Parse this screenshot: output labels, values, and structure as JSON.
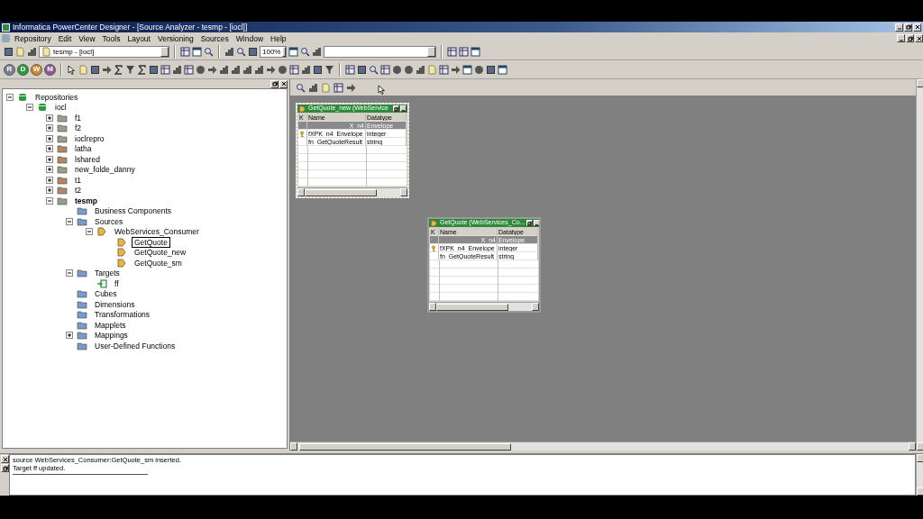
{
  "window": {
    "title": "Informatica PowerCenter Designer - [Source Analyzer - tesmp - [iocl]]"
  },
  "menu": [
    "Repository",
    "Edit",
    "View",
    "Tools",
    "Layout",
    "Versioning",
    "Sources",
    "Window",
    "Help"
  ],
  "toolbar": {
    "repository_combo": "tesmp - [iocl]",
    "zoom_combo": "100%"
  },
  "client_tools": [
    {
      "label": "R",
      "color": "#7a7f9a"
    },
    {
      "label": "D",
      "color": "#2f9a3a"
    },
    {
      "label": "W",
      "color": "#d8862a"
    },
    {
      "label": "M",
      "color": "#8a5a9a"
    }
  ],
  "tree": [
    {
      "label": "Repositories",
      "kind": "repositories",
      "selected": false,
      "expanded": true,
      "children": [
        {
          "label": "iocl",
          "kind": "repository",
          "selected": false,
          "expanded": true,
          "children": [
            {
              "label": "f1",
              "kind": "folder",
              "selected": false,
              "expanded": false
            },
            {
              "label": "f2",
              "kind": "folder",
              "selected": false,
              "expanded": false
            },
            {
              "label": "ioclrepro",
              "kind": "folder",
              "selected": false,
              "expanded": false
            },
            {
              "label": "latha",
              "kind": "shared-folder",
              "selected": false,
              "expanded": false
            },
            {
              "label": "lshared",
              "kind": "shared-folder",
              "selected": false,
              "expanded": false
            },
            {
              "label": "new_folde_danny",
              "kind": "folder",
              "selected": false,
              "expanded": false
            },
            {
              "label": "t1",
              "kind": "shared-folder",
              "selected": false,
              "expanded": false
            },
            {
              "label": "t2",
              "kind": "shared-folder",
              "selected": false,
              "expanded": false
            },
            {
              "label": "tesmp",
              "kind": "open-folder",
              "selected": false,
              "expanded": true,
              "children": [
                {
                  "label": "Business Components",
                  "kind": "node",
                  "selected": false
                },
                {
                  "label": "Sources",
                  "kind": "node",
                  "selected": false,
                  "expanded": true,
                  "children": [
                    {
                      "label": "WebServices_Consumer",
                      "kind": "source",
                      "selected": false,
                      "expanded": true,
                      "children": [
                        {
                          "label": "GetQuote",
                          "kind": "source",
                          "selected": true
                        },
                        {
                          "label": "GetQuote_new",
                          "kind": "source",
                          "selected": false
                        },
                        {
                          "label": "GetQuote_sm",
                          "kind": "source",
                          "selected": false
                        }
                      ]
                    }
                  ]
                },
                {
                  "label": "Targets",
                  "kind": "node",
                  "selected": false,
                  "expanded": true,
                  "children": [
                    {
                      "label": "ff",
                      "kind": "target",
                      "selected": false
                    }
                  ]
                },
                {
                  "label": "Cubes",
                  "kind": "node",
                  "selected": false
                },
                {
                  "label": "Dimensions",
                  "kind": "node",
                  "selected": false
                },
                {
                  "label": "Transformations",
                  "kind": "node",
                  "selected": false
                },
                {
                  "label": "Mapplets",
                  "kind": "node",
                  "selected": false
                },
                {
                  "label": "Mappings",
                  "kind": "node",
                  "selected": false,
                  "expanded": false
                },
                {
                  "label": "User-Defined Functions",
                  "kind": "node",
                  "selected": false
                }
              ]
            }
          ]
        }
      ]
    }
  ],
  "source_windows": [
    {
      "title": "GetQuote_new (WebService",
      "selected": true,
      "columns": [
        "K",
        "Name",
        "Datatype"
      ],
      "rows": [
        {
          "kind": "group",
          "name": "X_n4",
          "datatype": "Envelope"
        },
        {
          "kind": "key",
          "name": "fXPK_n4_Envelope",
          "datatype": "integer"
        },
        {
          "kind": "field",
          "name": "fn_GetQuoteResult",
          "datatype": "string"
        }
      ]
    },
    {
      "title": "GetQuote (WebServices_Co...",
      "selected": false,
      "columns": [
        "K",
        "Name",
        "Datatype"
      ],
      "rows": [
        {
          "kind": "group",
          "name": "X_n4",
          "datatype": "Envelope"
        },
        {
          "kind": "key",
          "name": "fXPK_n4_Envelope",
          "datatype": "integer"
        },
        {
          "kind": "field",
          "name": "fn_GetQuoteResult",
          "datatype": "string"
        }
      ]
    }
  ],
  "output": [
    "source WebServices_Consumer:GetQuote_sm inserted.",
    "Target ff updated."
  ]
}
